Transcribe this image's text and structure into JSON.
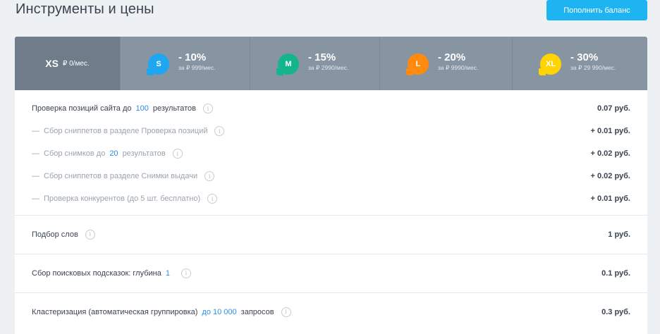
{
  "header": {
    "title": "Инструменты и цены",
    "topup_button": "Пополнить баланс"
  },
  "tariffs": {
    "xs": {
      "name": "XS",
      "price": "₽ 0/мес."
    },
    "s": {
      "badge": "S",
      "discount": "- 10%",
      "price": "за ₽ 999/мес.",
      "color": "#1ea7f0"
    },
    "m": {
      "badge": "M",
      "discount": "- 15%",
      "price": "за ₽ 2990/мес.",
      "color": "#14b58c"
    },
    "l": {
      "badge": "L",
      "discount": "- 20%",
      "price": "за ₽ 9990/мес.",
      "color": "#ff8a0e"
    },
    "xl": {
      "badge": "XL",
      "discount": "- 30%",
      "price": "за ₽ 29 990/мес.",
      "color": "#ffd400"
    }
  },
  "pricing": {
    "positions": {
      "label_before": "Проверка позиций сайта до",
      "link": "100",
      "label_after": "результатов",
      "price": "0.07 руб.",
      "subs": [
        {
          "dash": "—",
          "label": "Сбор сниппетов в разделе Проверка позиций",
          "price": "+ 0.01 руб."
        },
        {
          "dash": "—",
          "label_before": "Сбор снимков до",
          "link": "20",
          "label_after": "результатов",
          "price": "+ 0.02 руб."
        },
        {
          "dash": "—",
          "label": "Сбор сниппетов в разделе Снимки выдачи",
          "price": "+ 0.02 руб."
        },
        {
          "dash": "—",
          "label": "Проверка конкурентов (до 5 шт. бесплатно)",
          "price": "+ 0.01 руб."
        }
      ]
    },
    "words": {
      "label": "Подбор слов",
      "price": "1 руб."
    },
    "suggest": {
      "label": "Сбор поисковых подсказок: глубина",
      "link": "1",
      "price": "0.1 руб."
    },
    "cluster": {
      "label": "Кластеризация (автоматическая группировка)",
      "link": "до 10 000",
      "label_after": "запросов",
      "price": "0.3 руб."
    },
    "info_glyph": "i"
  }
}
